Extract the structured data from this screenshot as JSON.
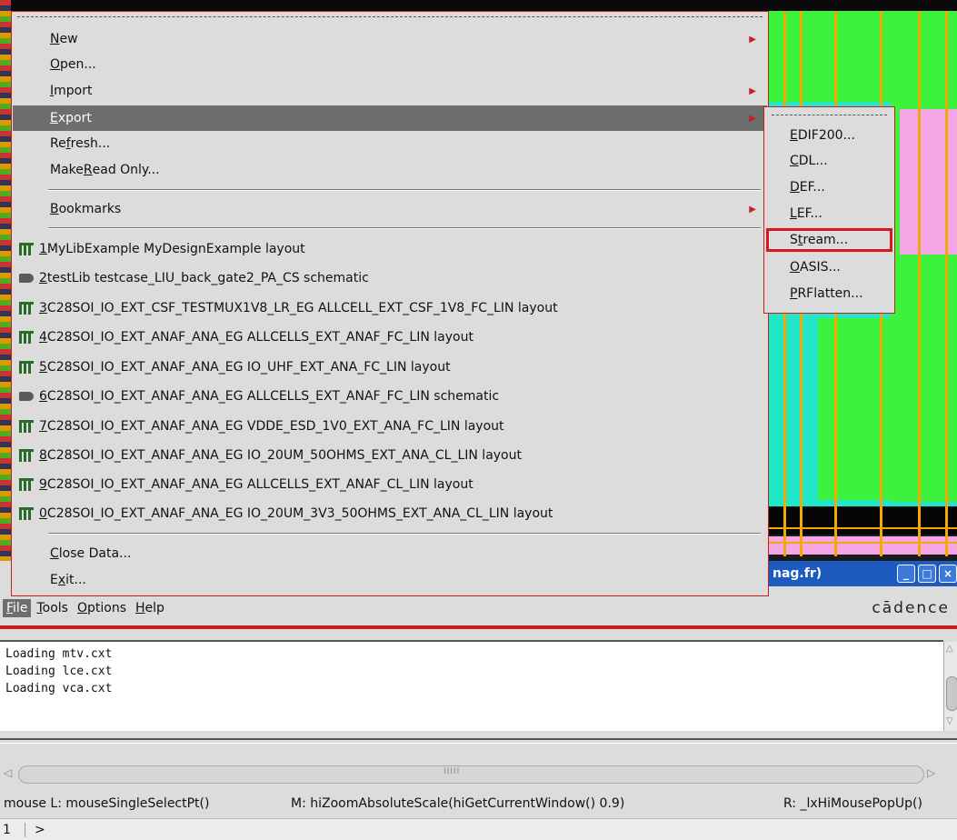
{
  "file_menu": {
    "items": [
      {
        "label": "New",
        "mnemonic": "N",
        "rest": "ew",
        "submenu": true
      },
      {
        "label": "Open...",
        "mnemonic": "O",
        "rest": "pen...",
        "submenu": false
      },
      {
        "label": "Import",
        "mnemonic": "I",
        "rest": "mport",
        "submenu": true
      },
      {
        "label": "Export",
        "mnemonic": "E",
        "rest": "xport",
        "submenu": true,
        "highlighted": true
      },
      {
        "label": "Refresh...",
        "pre": "Re",
        "mnemonic": "f",
        "rest": "resh...",
        "submenu": false
      },
      {
        "label": "Make Read Only...",
        "pre": "Make ",
        "mnemonic": "R",
        "rest": "ead Only...",
        "submenu": false
      }
    ],
    "bookmarks": {
      "mnemonic": "B",
      "rest": "ookmarks"
    },
    "recent": [
      {
        "num": "1",
        "text": " MyLibExample  MyDesignExample  layout",
        "icon": "layout-icon"
      },
      {
        "num": "2",
        "text": " testLib  testcase_LIU_back_gate2_PA_CS  schematic",
        "icon": "schematic-icon"
      },
      {
        "num": "3",
        "text": " C28SOI_IO_EXT_CSF_TESTMUX1V8_LR_EG  ALLCELL_EXT_CSF_1V8_FC_LIN  layout",
        "icon": "layout-icon"
      },
      {
        "num": "4",
        "text": " C28SOI_IO_EXT_ANAF_ANA_EG  ALLCELLS_EXT_ANAF_FC_LIN  layout",
        "icon": "layout-icon"
      },
      {
        "num": "5",
        "text": " C28SOI_IO_EXT_ANAF_ANA_EG  IO_UHF_EXT_ANA_FC_LIN  layout",
        "icon": "layout-icon"
      },
      {
        "num": "6",
        "text": " C28SOI_IO_EXT_ANAF_ANA_EG  ALLCELLS_EXT_ANAF_FC_LIN  schematic",
        "icon": "schematic-icon"
      },
      {
        "num": "7",
        "text": " C28SOI_IO_EXT_ANAF_ANA_EG  VDDE_ESD_1V0_EXT_ANA_FC_LIN  layout",
        "icon": "layout-icon"
      },
      {
        "num": "8",
        "text": " C28SOI_IO_EXT_ANAF_ANA_EG  IO_20UM_50OHMS_EXT_ANA_CL_LIN  layout",
        "icon": "layout-icon"
      },
      {
        "num": "9",
        "text": " C28SOI_IO_EXT_ANAF_ANA_EG  ALLCELLS_EXT_ANAF_CL_LIN  layout",
        "icon": "layout-icon"
      },
      {
        "num": "0",
        "text": " C28SOI_IO_EXT_ANAF_ANA_EG  IO_20UM_3V3_50OHMS_EXT_ANA_CL_LIN  layout",
        "icon": "layout-icon"
      }
    ],
    "close_data": {
      "mnemonic": "C",
      "rest": "lose Data..."
    },
    "exit": {
      "pre": "E",
      "mnemonic": "x",
      "rest": "it..."
    }
  },
  "export_menu": {
    "items": [
      {
        "mnemonic": "E",
        "rest": "DIF200..."
      },
      {
        "mnemonic": "C",
        "rest": "DL..."
      },
      {
        "mnemonic": "D",
        "rest": "EF..."
      },
      {
        "mnemonic": "L",
        "rest": "EF..."
      },
      {
        "pre": "S",
        "mnemonic": "t",
        "rest": "ream...",
        "boxed": true
      },
      {
        "mnemonic": "O",
        "rest": "ASIS..."
      },
      {
        "mnemonic": "P",
        "rest": "RFlatten..."
      }
    ]
  },
  "bg_window": {
    "title_fragment": "nag.fr)",
    "buttons": [
      "_",
      "□",
      "×"
    ]
  },
  "menubar": {
    "items": [
      {
        "mnemonic": "F",
        "rest": "ile",
        "active": true
      },
      {
        "mnemonic": "T",
        "rest": "ools"
      },
      {
        "mnemonic": "O",
        "rest": "ptions"
      },
      {
        "mnemonic": "H",
        "rest": "elp"
      }
    ],
    "brand": "cādence"
  },
  "console": {
    "lines": [
      "Loading mtv.cxt",
      "Loading lce.cxt",
      "Loading vca.cxt"
    ]
  },
  "mouse_status": {
    "left": "mouse L: mouseSingleSelectPt()",
    "middle": "M: hiZoomAbsoluteScale(hiGetCurrentWindow() 0.9)",
    "right": "R: _lxHiMousePopUp()"
  },
  "command_line": {
    "number": "1",
    "prompt": ">"
  },
  "colors": {
    "accent_red": "#c81e1e",
    "highlight_gray": "#6e6e6e",
    "layout_cyan": "#22e6c8",
    "layout_green": "#3cf23c",
    "layout_gold": "#f2a900"
  }
}
